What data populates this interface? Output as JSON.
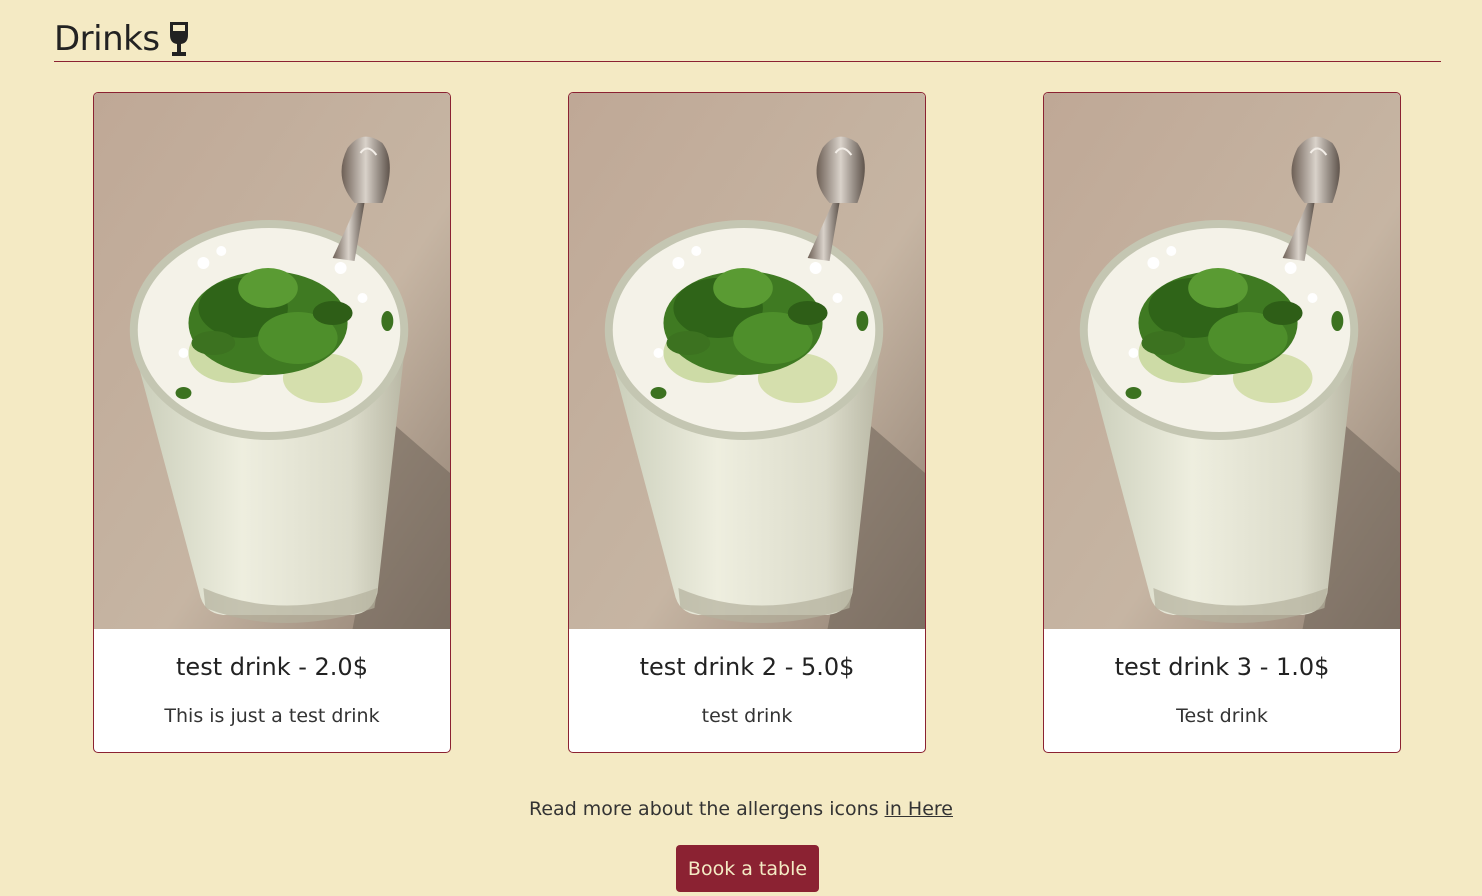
{
  "section": {
    "title": "Drinks",
    "icon": "wine-glass-icon"
  },
  "drinks": [
    {
      "name_price": "test drink - 2.0$",
      "description": "This is just a test drink"
    },
    {
      "name_price": "test drink 2 - 5.0$",
      "description": "test drink"
    },
    {
      "name_price": "test drink 3 - 1.0$",
      "description": "Test drink"
    }
  ],
  "allergens": {
    "text": "Read more about the allergens icons ",
    "link_label": "in Here"
  },
  "actions": {
    "book_label": "Book a table"
  },
  "colors": {
    "background": "#f4eac4",
    "accent": "#8b2232"
  }
}
